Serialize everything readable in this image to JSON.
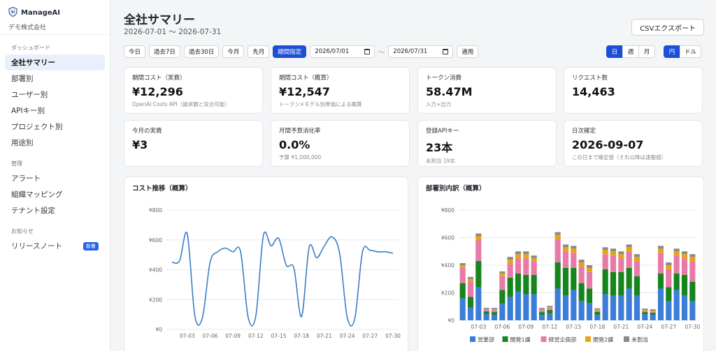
{
  "brand": {
    "name": "ManageAI",
    "org": "デモ株式会社"
  },
  "nav": {
    "sections": [
      {
        "label": "ダッシュボード",
        "items": [
          {
            "label": "全社サマリー",
            "active": true
          },
          {
            "label": "部署別"
          },
          {
            "label": "ユーザー別"
          },
          {
            "label": "APIキー別"
          },
          {
            "label": "プロジェクト別"
          },
          {
            "label": "用途別"
          }
        ]
      },
      {
        "label": "管理",
        "items": [
          {
            "label": "アラート"
          },
          {
            "label": "組織マッピング"
          },
          {
            "label": "テナント設定"
          }
        ]
      },
      {
        "label": "お知らせ",
        "items": [
          {
            "label": "リリースノート",
            "badge": "新着"
          }
        ]
      }
    ]
  },
  "header": {
    "title": "全社サマリー",
    "range": "2026-07-01 〜 2026-07-31",
    "export_label": "CSVエクスポート"
  },
  "toolbar": {
    "presets": [
      "今日",
      "過去7日",
      "過去30日",
      "今月",
      "先月",
      "期間指定"
    ],
    "active_preset": "期間指定",
    "date_from": "2026/07/01",
    "date_to": "2026/07/31",
    "separator": "〜",
    "apply_label": "適用",
    "granularity": [
      "日",
      "週",
      "月"
    ],
    "active_granularity": "日",
    "currency": [
      "円",
      "ドル"
    ],
    "active_currency": "円"
  },
  "kpis": [
    {
      "label": "期間コスト（実費）",
      "value": "¥12,296",
      "sub": "OpenAI Costs API（請求額と突合可能）"
    },
    {
      "label": "期間コスト（概算）",
      "value": "¥12,547",
      "sub": "トークン×モデル別単価による概算"
    },
    {
      "label": "トークン消費",
      "value": "58.47M",
      "sub": "入力+出力"
    },
    {
      "label": "リクエスト数",
      "value": "14,463",
      "sub": ""
    },
    {
      "label": "今月の実費",
      "value": "¥3",
      "sub": ""
    },
    {
      "label": "月間予算消化率",
      "value": "0.0%",
      "sub": "予算 ¥1,000,000"
    },
    {
      "label": "登録APIキー",
      "value": "23本",
      "sub": "未割当 19本"
    },
    {
      "label": "日次確定",
      "value": "2026-09-07",
      "sub": "この日まで確定値（それ以降は速報値）"
    }
  ],
  "colors": {
    "accent": "#1d4ed8",
    "line": "#3b7dc4",
    "sales": "#3b7dd8",
    "dev1": "#16851c",
    "planning": "#e87aa8",
    "dev2": "#e5a511",
    "unassigned": "#8a8a8a"
  },
  "chart_data": [
    {
      "type": "line",
      "title": "コスト推移（概算）",
      "x": [
        "07-01",
        "07-02",
        "07-03",
        "07-04",
        "07-05",
        "07-06",
        "07-07",
        "07-08",
        "07-09",
        "07-10",
        "07-11",
        "07-12",
        "07-13",
        "07-14",
        "07-15",
        "07-16",
        "07-17",
        "07-18",
        "07-19",
        "07-20",
        "07-21",
        "07-22",
        "07-23",
        "07-24",
        "07-25",
        "07-26",
        "07-27",
        "07-28",
        "07-29",
        "07-30"
      ],
      "xticks": [
        "07-03",
        "07-06",
        "07-09",
        "07-12",
        "07-15",
        "07-18",
        "07-21",
        "07-24",
        "07-27",
        "07-30"
      ],
      "series": [
        {
          "values": [
            450,
            460,
            640,
            90,
            80,
            450,
            520,
            545,
            520,
            520,
            80,
            90,
            630,
            560,
            610,
            430,
            410,
            85,
            550,
            480,
            560,
            620,
            510,
            80,
            75,
            520,
            530,
            520,
            520,
            510
          ]
        }
      ],
      "ylim": [
        0,
        800
      ],
      "yticks": [
        "¥0",
        "¥200",
        "¥400",
        "¥600",
        "¥800"
      ],
      "grid": true
    },
    {
      "type": "bar",
      "stacked": true,
      "title": "部署別内訳（概算）",
      "categories": [
        "07-01",
        "07-02",
        "07-03",
        "07-04",
        "07-05",
        "07-06",
        "07-07",
        "07-08",
        "07-09",
        "07-10",
        "07-11",
        "07-12",
        "07-13",
        "07-14",
        "07-15",
        "07-16",
        "07-17",
        "07-18",
        "07-19",
        "07-20",
        "07-21",
        "07-22",
        "07-23",
        "07-24",
        "07-25",
        "07-26",
        "07-27",
        "07-28",
        "07-29",
        "07-30"
      ],
      "xticks": [
        "07-03",
        "07-06",
        "07-09",
        "07-12",
        "07-15",
        "07-18",
        "07-21",
        "07-24",
        "07-27",
        "07-30"
      ],
      "series": [
        {
          "name": "営業部",
          "values": [
            160,
            90,
            240,
            45,
            40,
            120,
            170,
            210,
            190,
            190,
            40,
            50,
            230,
            180,
            220,
            140,
            125,
            40,
            190,
            180,
            180,
            230,
            180,
            45,
            40,
            230,
            140,
            220,
            180,
            140
          ]
        },
        {
          "name": "開発1課",
          "values": [
            110,
            80,
            190,
            20,
            20,
            100,
            140,
            130,
            140,
            140,
            20,
            25,
            190,
            200,
            160,
            130,
            105,
            22,
            180,
            170,
            170,
            150,
            140,
            15,
            15,
            110,
            100,
            120,
            150,
            140
          ]
        },
        {
          "name": "経営企画部",
          "values": [
            110,
            110,
            150,
            10,
            15,
            100,
            100,
            110,
            120,
            100,
            15,
            15,
            170,
            120,
            110,
            120,
            120,
            10,
            110,
            120,
            100,
            120,
            110,
            10,
            10,
            150,
            130,
            130,
            120,
            150
          ]
        },
        {
          "name": "開発2課",
          "values": [
            20,
            20,
            30,
            5,
            5,
            20,
            30,
            30,
            30,
            20,
            5,
            5,
            30,
            30,
            30,
            30,
            30,
            5,
            30,
            30,
            30,
            30,
            30,
            5,
            5,
            30,
            30,
            30,
            30,
            30
          ]
        },
        {
          "name": "未割当",
          "values": [
            15,
            15,
            20,
            10,
            10,
            15,
            20,
            20,
            20,
            20,
            10,
            10,
            20,
            20,
            20,
            20,
            20,
            10,
            20,
            20,
            20,
            20,
            20,
            10,
            10,
            20,
            20,
            20,
            20,
            20
          ]
        }
      ],
      "ylim": [
        0,
        800
      ],
      "yticks": [
        "¥0",
        "¥200",
        "¥400",
        "¥600",
        "¥800"
      ],
      "legend": "bottom",
      "grid": true
    }
  ]
}
